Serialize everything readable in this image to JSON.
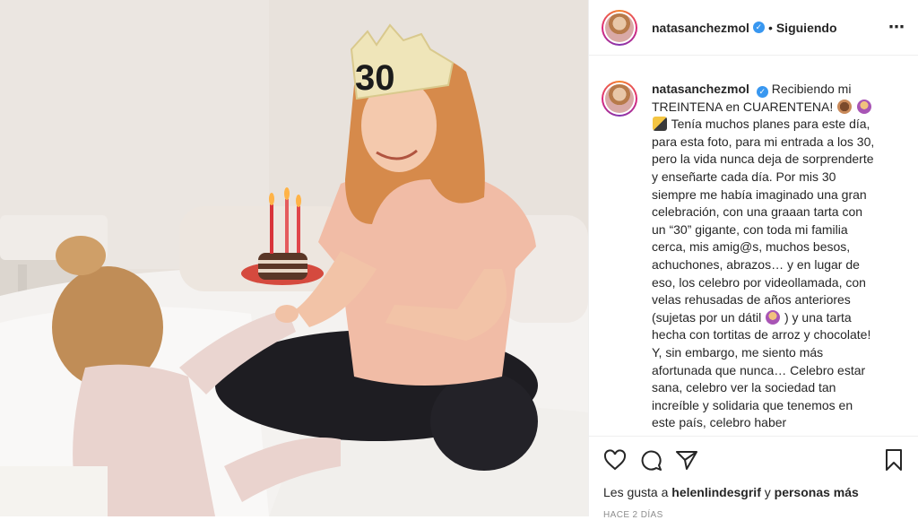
{
  "post": {
    "username": "natasanchezmol",
    "verified_mark": "✓",
    "separator": "•",
    "follow_status": "Siguiendo",
    "more_icon": "⋯"
  },
  "caption": {
    "username": "natasanchezmol",
    "text_1": "Recibiendo mi TREINTENA en CUARENTENA!",
    "text_2": "Tenía muchos planes para este día, para esta foto, para mi entrada a los 30, pero la vida nunca deja de sorprenderte y enseñarte cada día. Por mis 30 siempre me había imaginado una gran celebración, con una graaan tarta con un “30” gigante, con toda mi familia cerca, mis amig@s, muchos besos, achuchones, abrazos… y en lugar de eso, los celebro por videollamada, con velas rehusadas de años anteriores (sujetas por un dátil",
    "text_3": ") y una tarta hecha con tortitas de arroz y chocolate! Y, sin embargo, me siento más afortunada que nunca… Celebro estar sana, celebro ver la sociedad tan increíble y solidaria que tenemos en este país, celebro haber",
    "emojis": [
      "cake-emoji",
      "woman-gesture-emoji",
      "party-popper-emoji",
      "woman-shrug-emoji"
    ]
  },
  "photo": {
    "crown_text": "30",
    "description_icons": [
      "birthday-cake",
      "candles"
    ]
  },
  "actions": {
    "likes_prefix": "Les gusta a",
    "likes_user": "helenlindesgrif",
    "likes_conj": "y",
    "likes_others": "personas más",
    "time_ago": "HACE 2 DÍAS"
  },
  "colors": {
    "verified": "#3897f0",
    "text": "#262626",
    "muted": "#8e8e8e",
    "border": "#efefef"
  }
}
